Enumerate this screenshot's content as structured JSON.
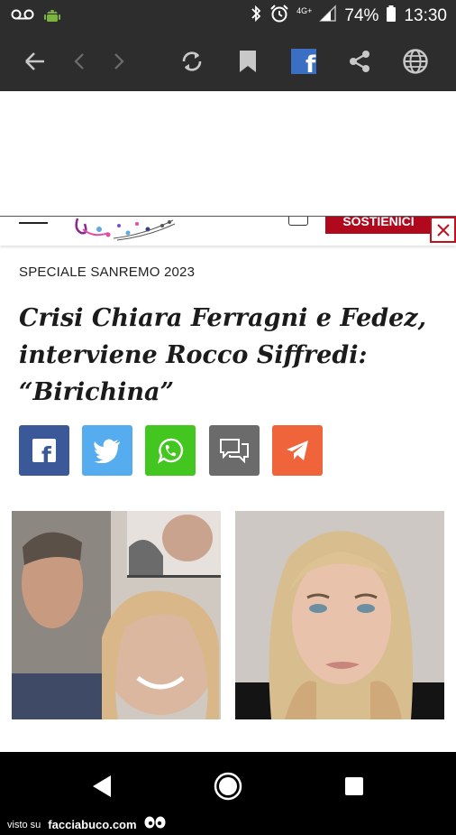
{
  "status_bar": {
    "network": "4G+",
    "battery": "74%",
    "time": "13:30",
    "icons": [
      "voicemail-icon",
      "android-icon",
      "bluetooth-icon",
      "alarm-icon",
      "signal-icon",
      "battery-icon"
    ]
  },
  "toolbar": {
    "icons": [
      "back-arrow-icon",
      "prev-icon",
      "next-icon",
      "reload-icon",
      "bookmark-icon",
      "facebook-icon",
      "share-icon",
      "globe-icon"
    ],
    "facebook_glyph": "f"
  },
  "site_header": {
    "subscribe_label": "SOSTIENICI",
    "close_glyph": "✕"
  },
  "article": {
    "category": "SPECIALE SANREMO 2023",
    "headline": "Crisi Chiara Ferragni e Fedez, interviene Rocco Siffredi: “Birichina”"
  },
  "share_buttons": [
    {
      "name": "facebook",
      "color": "#3b5998",
      "glyph": "f"
    },
    {
      "name": "twitter",
      "color": "#55acee"
    },
    {
      "name": "whatsapp",
      "color": "#43c61f"
    },
    {
      "name": "comments",
      "color": "#6b6b6b"
    },
    {
      "name": "telegram",
      "color": "#f0643c"
    }
  ],
  "nav_bar": {
    "icons": [
      "back-triangle-icon",
      "home-circle-icon",
      "recents-square-icon"
    ]
  },
  "watermark": {
    "visto_su": "visto su",
    "site": "facciabuco.com"
  }
}
